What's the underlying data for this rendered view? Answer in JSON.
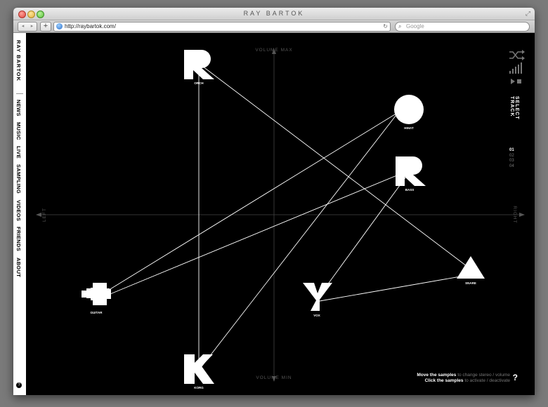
{
  "window": {
    "title": "RAY BARTOK"
  },
  "toolbar": {
    "back_icon": "◂",
    "forward_icon": "▸",
    "add_label": "+",
    "url": "http://raybartok.com/",
    "search_placeholder": "Google"
  },
  "sidebar": {
    "logo_text": "RAY BARTOK",
    "menu_items": [
      "NEWS",
      "MUSIC",
      "LIVE",
      "SAMPLING",
      "VIDEOS",
      "FRIENDS",
      "ABOUT"
    ]
  },
  "stage": {
    "axis_labels": {
      "top": "VOLUME MAX",
      "bottom": "VOLUME MIN",
      "left": "LEFT",
      "right": "RIGHT"
    },
    "samples": [
      {
        "id": "orch",
        "label": "ORCH",
        "shape": "r-shape"
      },
      {
        "id": "hihat",
        "label": "HIHAT",
        "shape": "circle"
      },
      {
        "id": "bass",
        "label": "BASS",
        "shape": "r-shape"
      },
      {
        "id": "snare",
        "label": "SNARE",
        "shape": "triangle"
      },
      {
        "id": "guitar",
        "label": "GUITAR",
        "shape": "cross"
      },
      {
        "id": "vox",
        "label": "VOX",
        "shape": "y-shape"
      },
      {
        "id": "korg",
        "label": "KORG",
        "shape": "k-shape"
      }
    ]
  },
  "controls": {
    "shuffle_icon": "shuffle-icon",
    "volume_icon": "volume-bars-icon",
    "play_icon": "play-icon",
    "stop_icon": "stop-icon"
  },
  "track_selector": {
    "title": "SELECT TRACK",
    "tracks": [
      "01",
      "02",
      "03",
      "04"
    ],
    "active": "01"
  },
  "hint": {
    "line1_bold": "Move the samples",
    "line1_dim": "to change stereo / volume",
    "line2_bold": "Click the samples",
    "line2_dim": "to activate / deactivate",
    "help": "?"
  },
  "colors": {
    "background": "#000000",
    "foreground": "#ffffff",
    "axis": "#555555",
    "sidebar": "#ffffff"
  }
}
